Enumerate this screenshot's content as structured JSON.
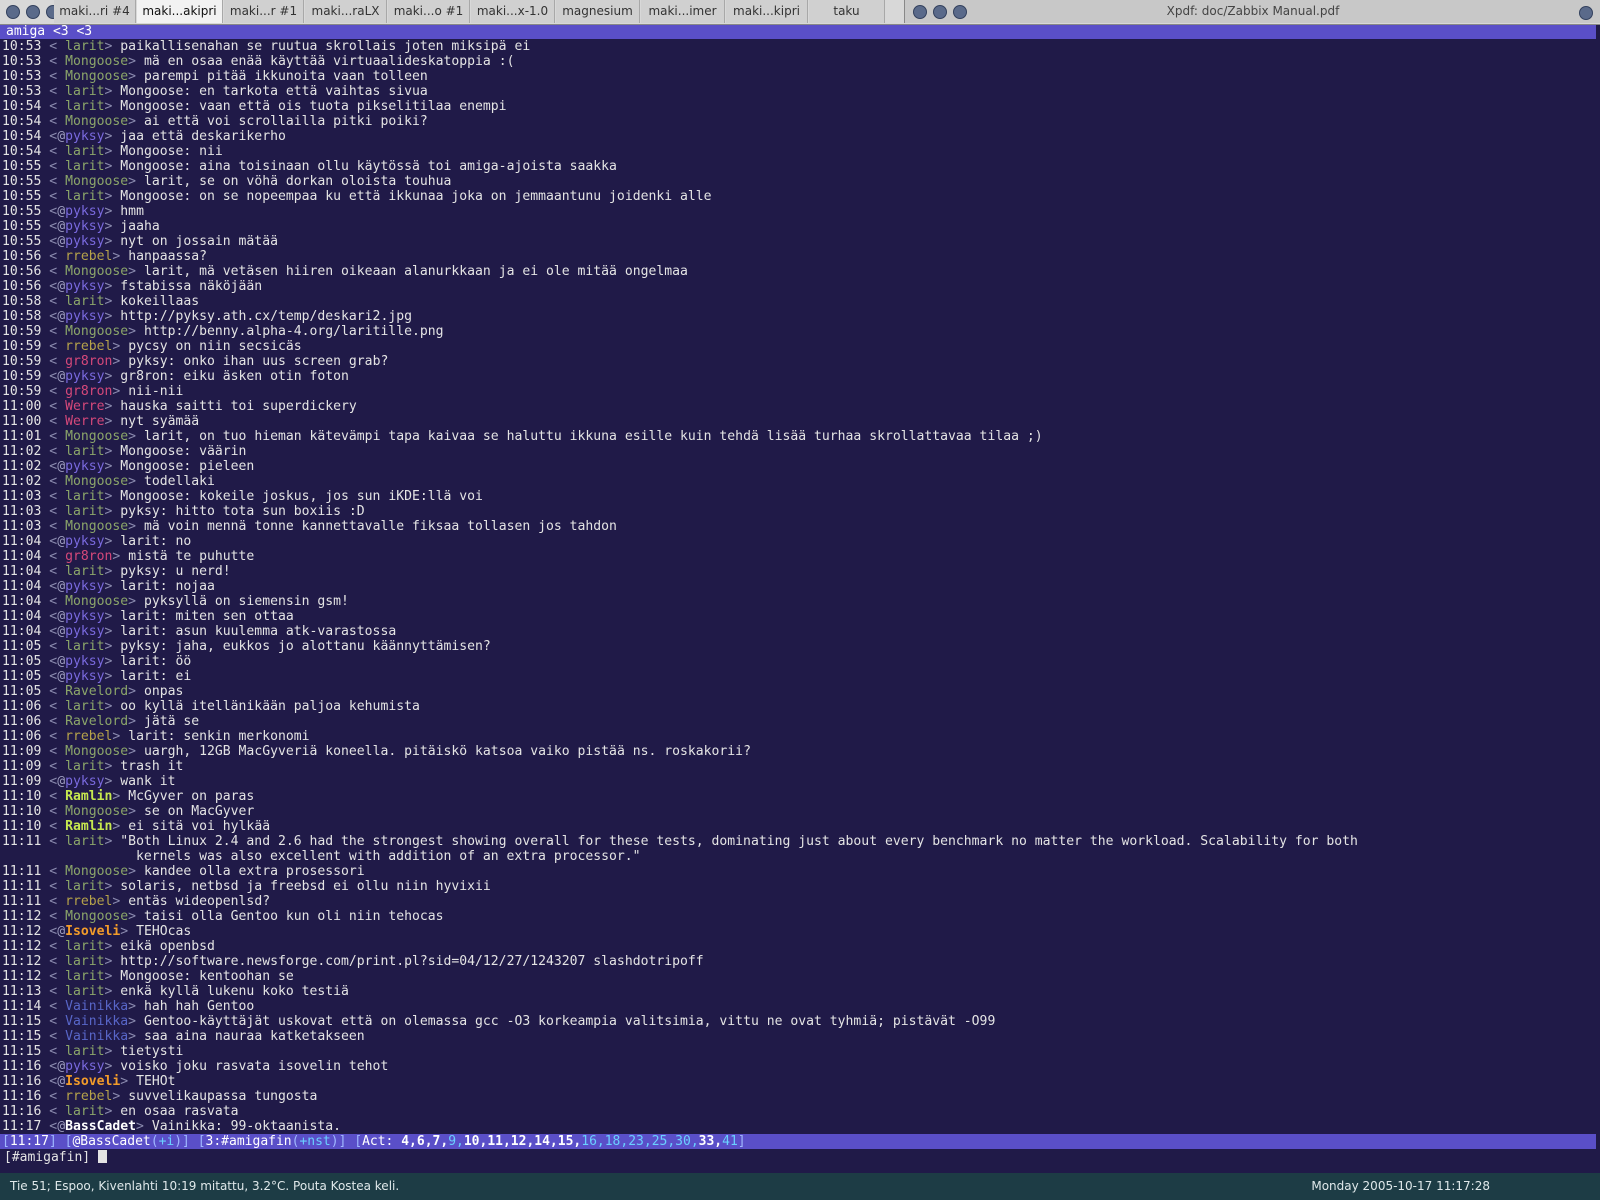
{
  "tabbar": {
    "tabs": [
      {
        "label": "maki...ri #4",
        "active": false
      },
      {
        "label": "maki...akipri",
        "active": true
      },
      {
        "label": "maki...r #1",
        "active": false
      },
      {
        "label": "maki...raLX",
        "active": false
      },
      {
        "label": "maki...o #1",
        "active": false
      },
      {
        "label": "maki...x-1.0",
        "active": false
      },
      {
        "label": "magnesium",
        "active": false
      },
      {
        "label": "maki...imer",
        "active": false
      },
      {
        "label": "maki...kipri",
        "active": false
      },
      {
        "label": "taku",
        "active": false
      }
    ]
  },
  "xpdf": {
    "title": "Xpdf: doc/Zabbix Manual.pdf"
  },
  "irc": {
    "topic": "amiga <3 <3",
    "lines": [
      {
        "time": "10:53",
        "mode": " ",
        "nick": "larit",
        "cls": "",
        "msg": "paikallisenahan se ruutua skrollais joten miksipä ei"
      },
      {
        "time": "10:53",
        "mode": " ",
        "nick": "Mongoose",
        "cls": "",
        "msg": "mä en osaa enää käyttää virtuaalideskatoppia :("
      },
      {
        "time": "10:53",
        "mode": " ",
        "nick": "Mongoose",
        "cls": "",
        "msg": "parempi pitää ikkunoita vaan tolleen"
      },
      {
        "time": "10:53",
        "mode": " ",
        "nick": "larit",
        "cls": "",
        "msg": "Mongoose: en tarkota että vaihtas sivua"
      },
      {
        "time": "10:54",
        "mode": " ",
        "nick": "larit",
        "cls": "",
        "msg": "Mongoose: vaan että ois tuota pikselitilaa enempi"
      },
      {
        "time": "10:54",
        "mode": " ",
        "nick": "Mongoose",
        "cls": "",
        "msg": "ai että voi scrollailla pitki poiki?"
      },
      {
        "time": "10:54",
        "mode": "@",
        "nick": "pyksy",
        "cls": "op",
        "msg": "jaa että deskarikerho"
      },
      {
        "time": "10:54",
        "mode": " ",
        "nick": "larit",
        "cls": "",
        "msg": "Mongoose: nii"
      },
      {
        "time": "10:55",
        "mode": " ",
        "nick": "larit",
        "cls": "",
        "msg": "Mongoose: aina toisinaan ollu käytössä toi amiga-ajoista saakka"
      },
      {
        "time": "10:55",
        "mode": " ",
        "nick": "Mongoose",
        "cls": "",
        "msg": "larit, se on vöhä dorkan oloista touhua"
      },
      {
        "time": "10:55",
        "mode": " ",
        "nick": "larit",
        "cls": "",
        "msg": "Mongoose: on se nopeempaa ku että ikkunaa joka on jemmaantunu joidenki alle"
      },
      {
        "time": "10:55",
        "mode": "@",
        "nick": "pyksy",
        "cls": "op",
        "msg": "hmm"
      },
      {
        "time": "10:55",
        "mode": "@",
        "nick": "pyksy",
        "cls": "op",
        "msg": "jaaha"
      },
      {
        "time": "10:55",
        "mode": "@",
        "nick": "pyksy",
        "cls": "op",
        "msg": "nyt on jossain mätää"
      },
      {
        "time": "10:56",
        "mode": " ",
        "nick": "rrebel",
        "cls": "brown",
        "msg": "hanpaassa?"
      },
      {
        "time": "10:56",
        "mode": " ",
        "nick": "Mongoose",
        "cls": "",
        "msg": "larit, mä vetäsen hiiren oikeaan alanurkkaan ja ei ole mitää ongelmaa"
      },
      {
        "time": "10:56",
        "mode": "@",
        "nick": "pyksy",
        "cls": "op",
        "msg": "fstabissa näköjään"
      },
      {
        "time": "10:58",
        "mode": " ",
        "nick": "larit",
        "cls": "",
        "msg": "kokeillaas"
      },
      {
        "time": "10:58",
        "mode": "@",
        "nick": "pyksy",
        "cls": "op",
        "msg": "http://pyksy.ath.cx/temp/deskari2.jpg"
      },
      {
        "time": "10:59",
        "mode": " ",
        "nick": "Mongoose",
        "cls": "",
        "msg": "http://benny.alpha-4.org/laritille.png"
      },
      {
        "time": "10:59",
        "mode": " ",
        "nick": "rrebel",
        "cls": "brown",
        "msg": "pycsy on niin secsicäs"
      },
      {
        "time": "10:59",
        "mode": " ",
        "nick": "gr8ron",
        "cls": "red",
        "msg": "pyksy: onko ihan uus screen grab?"
      },
      {
        "time": "10:59",
        "mode": "@",
        "nick": "pyksy",
        "cls": "op",
        "msg": "gr8ron: eiku äsken otin foton"
      },
      {
        "time": "10:59",
        "mode": " ",
        "nick": "gr8ron",
        "cls": "red",
        "msg": "nii-nii"
      },
      {
        "time": "11:00",
        "mode": " ",
        "nick": "Werre",
        "cls": "red",
        "msg": "hauska saitti toi superdickery"
      },
      {
        "time": "11:00",
        "mode": " ",
        "nick": "Werre",
        "cls": "red",
        "msg": "nyt syämää"
      },
      {
        "time": "11:01",
        "mode": " ",
        "nick": "Mongoose",
        "cls": "",
        "msg": "larit, on tuo hieman kätevämpi tapa kaivaa se haluttu ikkuna esille kuin tehdä lisää turhaa skrollattavaa tilaa ;)"
      },
      {
        "time": "11:02",
        "mode": " ",
        "nick": "larit",
        "cls": "",
        "msg": "Mongoose: väärin"
      },
      {
        "time": "11:02",
        "mode": "@",
        "nick": "pyksy",
        "cls": "op",
        "msg": "Mongoose: pieleen"
      },
      {
        "time": "11:02",
        "mode": " ",
        "nick": "Mongoose",
        "cls": "",
        "msg": "todellaki"
      },
      {
        "time": "11:03",
        "mode": " ",
        "nick": "larit",
        "cls": "",
        "msg": "Mongoose: kokeile joskus, jos sun iKDE:llä voi"
      },
      {
        "time": "11:03",
        "mode": " ",
        "nick": "larit",
        "cls": "",
        "msg": "pyksy: hitto tota sun boxiis :D"
      },
      {
        "time": "11:03",
        "mode": " ",
        "nick": "Mongoose",
        "cls": "",
        "msg": "mä voin mennä tonne kannettavalle fiksaa tollasen jos tahdon"
      },
      {
        "time": "11:04",
        "mode": "@",
        "nick": "pyksy",
        "cls": "op",
        "msg": "larit: no"
      },
      {
        "time": "11:04",
        "mode": " ",
        "nick": "gr8ron",
        "cls": "red",
        "msg": "mistä te puhutte"
      },
      {
        "time": "11:04",
        "mode": " ",
        "nick": "larit",
        "cls": "",
        "msg": "pyksy: u nerd!"
      },
      {
        "time": "11:04",
        "mode": "@",
        "nick": "pyksy",
        "cls": "op",
        "msg": "larit: nojaa"
      },
      {
        "time": "11:04",
        "mode": " ",
        "nick": "Mongoose",
        "cls": "",
        "msg": "pyksyllä on siemensin gsm!"
      },
      {
        "time": "11:04",
        "mode": "@",
        "nick": "pyksy",
        "cls": "op",
        "msg": "larit: miten sen ottaa"
      },
      {
        "time": "11:04",
        "mode": "@",
        "nick": "pyksy",
        "cls": "op",
        "msg": "larit: asun kuulemma atk-varastossa"
      },
      {
        "time": "11:05",
        "mode": " ",
        "nick": "larit",
        "cls": "",
        "msg": "pyksy: jaha, eukkos jo alottanu käännyttämisen?"
      },
      {
        "time": "11:05",
        "mode": "@",
        "nick": "pyksy",
        "cls": "op",
        "msg": "larit: öö"
      },
      {
        "time": "11:05",
        "mode": "@",
        "nick": "pyksy",
        "cls": "op",
        "msg": "larit: ei"
      },
      {
        "time": "11:05",
        "mode": " ",
        "nick": "Ravelord",
        "cls": "",
        "msg": "onpas"
      },
      {
        "time": "11:06",
        "mode": " ",
        "nick": "larit",
        "cls": "",
        "msg": "oo kyllä itellänikään paljoa kehumista"
      },
      {
        "time": "11:06",
        "mode": " ",
        "nick": "Ravelord",
        "cls": "",
        "msg": "jätä se"
      },
      {
        "time": "11:06",
        "mode": " ",
        "nick": "rrebel",
        "cls": "brown",
        "msg": "larit: senkin merkonomi"
      },
      {
        "time": "11:09",
        "mode": " ",
        "nick": "Mongoose",
        "cls": "",
        "msg": "uargh, 12GB MacGyveriä koneella. pitäiskö katsoa vaiko pistää ns. roskakorii?"
      },
      {
        "time": "11:09",
        "mode": " ",
        "nick": "larit",
        "cls": "",
        "msg": "trash it"
      },
      {
        "time": "11:09",
        "mode": "@",
        "nick": "pyksy",
        "cls": "op",
        "msg": "wank it"
      },
      {
        "time": "11:10",
        "mode": " ",
        "nick": "Ramlin",
        "cls": "bright",
        "msg": "McGyver on paras"
      },
      {
        "time": "11:10",
        "mode": " ",
        "nick": "Mongoose",
        "cls": "",
        "msg": "se on MacGyver"
      },
      {
        "time": "11:10",
        "mode": " ",
        "nick": "Ramlin",
        "cls": "bright",
        "msg": "ei sitä voi hylkää"
      },
      {
        "time": "11:11",
        "mode": " ",
        "nick": "larit",
        "cls": "",
        "msg": "\"Both Linux 2.4 and 2.6 had the strongest showing overall for these tests, dominating just about every benchmark no matter the workload. Scalability for both\n                 kernels was also excellent with addition of an extra processor.\"",
        "wrap": true
      },
      {
        "time": "11:11",
        "mode": " ",
        "nick": "Mongoose",
        "cls": "",
        "msg": "kandee olla extra prosessori"
      },
      {
        "time": "11:11",
        "mode": " ",
        "nick": "larit",
        "cls": "",
        "msg": "solaris, netbsd ja freebsd ei ollu niin hyvixii"
      },
      {
        "time": "11:11",
        "mode": " ",
        "nick": "rrebel",
        "cls": "brown",
        "msg": "entäs wideopenlsd?"
      },
      {
        "time": "11:12",
        "mode": " ",
        "nick": "Mongoose",
        "cls": "",
        "msg": "taisi olla Gentoo kun oli niin tehocas"
      },
      {
        "time": "11:12",
        "mode": "@",
        "nick": "Isoveli",
        "cls": "orange",
        "msg": "TEHOcas"
      },
      {
        "time": "11:12",
        "mode": " ",
        "nick": "larit",
        "cls": "",
        "msg": "eikä openbsd"
      },
      {
        "time": "11:12",
        "mode": " ",
        "nick": "larit",
        "cls": "",
        "msg": "http://software.newsforge.com/print.pl?sid=04/12/27/1243207 slashdotripoff"
      },
      {
        "time": "11:12",
        "mode": " ",
        "nick": "larit",
        "cls": "",
        "msg": "Mongoose: kentoohan se"
      },
      {
        "time": "11:13",
        "mode": " ",
        "nick": "larit",
        "cls": "",
        "msg": "enkä kyllä lukenu koko testiä"
      },
      {
        "time": "11:14",
        "mode": " ",
        "nick": "Vainikka",
        "cls": "vain",
        "msg": "hah hah Gentoo"
      },
      {
        "time": "11:15",
        "mode": " ",
        "nick": "Vainikka",
        "cls": "vain",
        "msg": "Gentoo-käyttäjät uskovat että on olemassa gcc -O3 korkeampia valitsimia, vittu ne ovat tyhmiä; pistävät -O99"
      },
      {
        "time": "11:15",
        "mode": " ",
        "nick": "Vainikka",
        "cls": "vain",
        "msg": "saa aina nauraa katketakseen"
      },
      {
        "time": "11:15",
        "mode": " ",
        "nick": "larit",
        "cls": "",
        "msg": "tietysti"
      },
      {
        "time": "11:16",
        "mode": "@",
        "nick": "pyksy",
        "cls": "op",
        "msg": "voisko joku rasvata isovelin tehot"
      },
      {
        "time": "11:16",
        "mode": "@",
        "nick": "Isoveli",
        "cls": "orange",
        "msg": "TEHOt"
      },
      {
        "time": "11:16",
        "mode": " ",
        "nick": "rrebel",
        "cls": "brown",
        "msg": "suvvelikaupassa tungosta"
      },
      {
        "time": "11:16",
        "mode": " ",
        "nick": "larit",
        "cls": "",
        "msg": "en osaa rasvata"
      },
      {
        "time": "11:17",
        "mode": "@",
        "nick": "BassCadet",
        "cls": "bold",
        "msg": "Vainikka: 99-oktaanista."
      }
    ]
  },
  "statusbar": {
    "time": "11:17",
    "nick": "@BassCadet",
    "usermode": "+i",
    "channel": "3:#amigafin",
    "chanmode": "+nst",
    "act_label": "Act:",
    "act_white": "4,6,7,",
    "act_dim": "9,",
    "act_bold": "10,11,12,14,15,",
    "act_cyan": "16,18,23,25,30,",
    "act_bold2": "33,",
    "act_cyan2": "41"
  },
  "input": {
    "prompt": "[#amigafin]"
  },
  "bottombar": {
    "weather": "Tie 51; Espoo, Kivenlahti 10:19 mitattu,   3.2°C. Pouta Kostea keli.",
    "clock": "Monday 2005-10-17 11:17:28"
  }
}
